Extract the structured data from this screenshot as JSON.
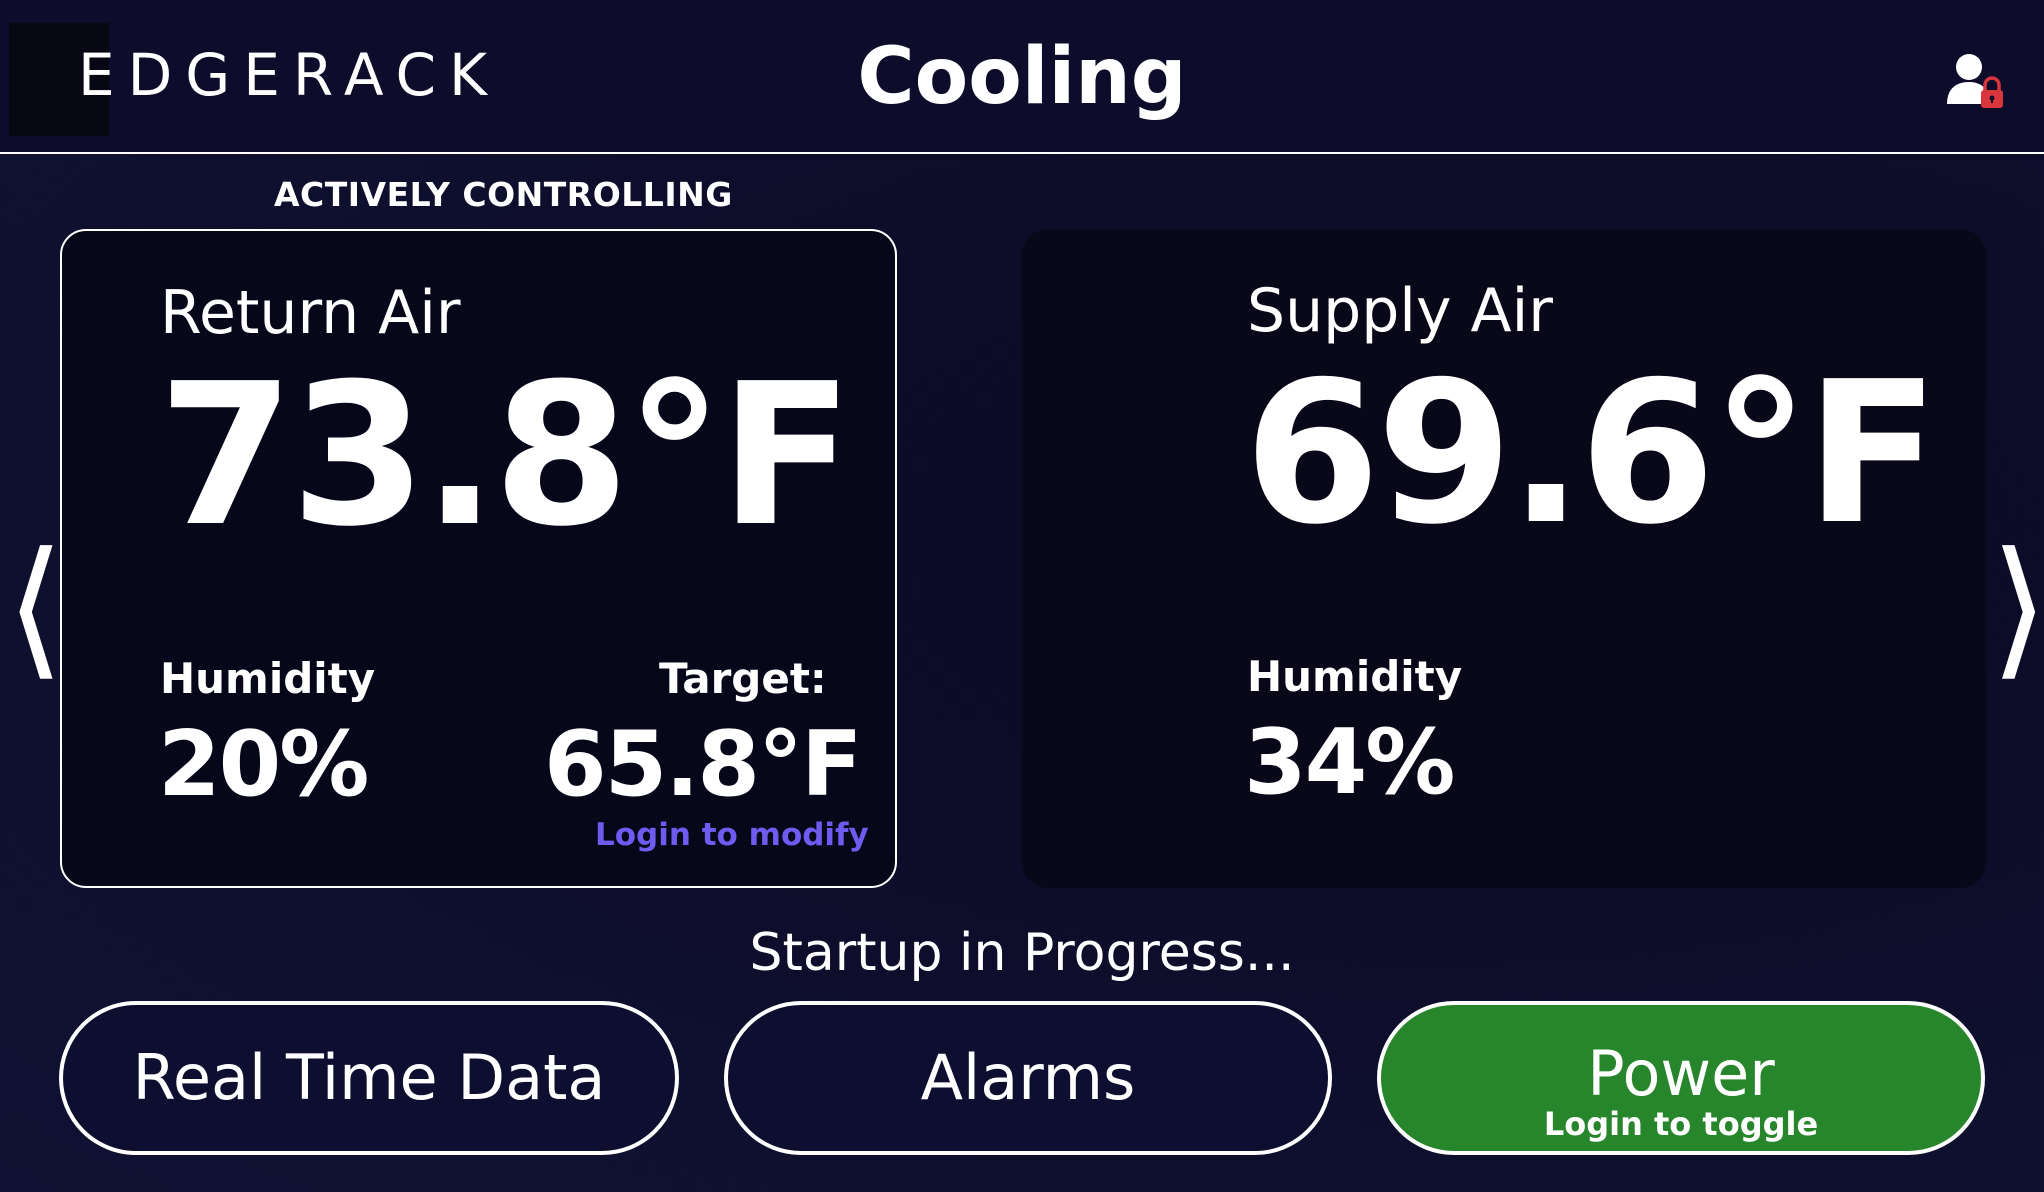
{
  "header": {
    "logo": "EDGERACK",
    "title": "Cooling",
    "user_icon": "user-lock-icon"
  },
  "status_label": "ACTIVELY CONTROLLING",
  "return_air": {
    "label": "Return Air",
    "temperature": "73.8°F",
    "humidity_label": "Humidity",
    "humidity": "20%",
    "target_label": "Target:",
    "target": "65.8°F",
    "login_link": "Login to modify"
  },
  "supply_air": {
    "label": "Supply Air",
    "temperature": "69.6°F",
    "humidity_label": "Humidity",
    "humidity": "34%"
  },
  "nav": {
    "prev": "⟨",
    "next": "⟩"
  },
  "status_message": "Startup in Progress...",
  "buttons": {
    "real_time_data": "Real Time Data",
    "alarms": "Alarms",
    "power": "Power",
    "power_sub": "Login to toggle"
  },
  "colors": {
    "background": "#0d0d2b",
    "power_green": "#27852b",
    "link_purple": "#6e5bef",
    "lock_red": "#d8353c"
  }
}
